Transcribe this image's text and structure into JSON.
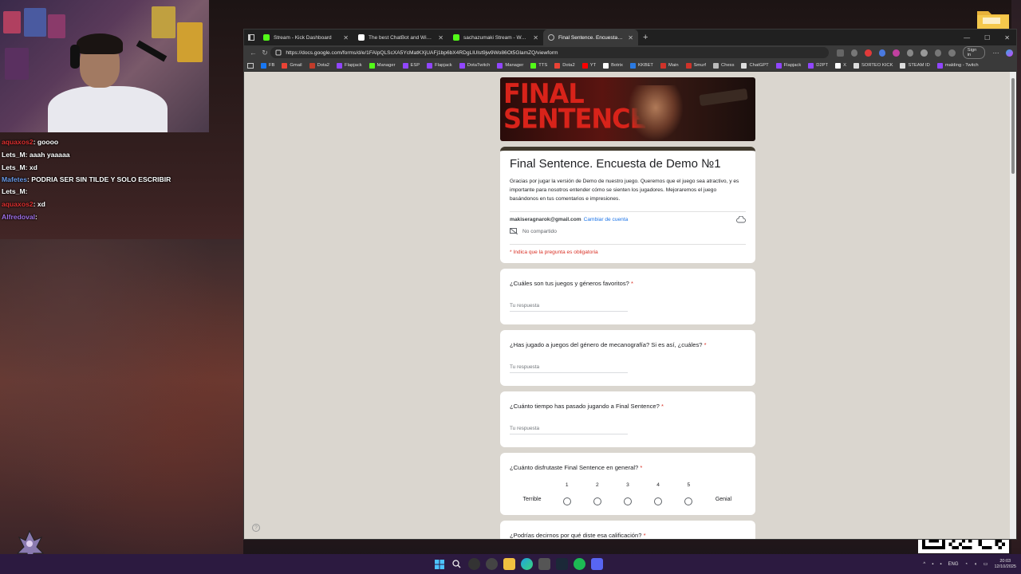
{
  "stream": {
    "chat": [
      {
        "user": "aquaxos2",
        "user_color": "#e03030",
        "text": ": goooo"
      },
      {
        "user": "Lets_M",
        "user_color": "#ffffff",
        "text": ": aaah yaaaaa"
      },
      {
        "user": "Lets_M",
        "user_color": "#ffffff",
        "text": ": xd"
      },
      {
        "user": "Mafetes",
        "user_color": "#6a9ae8",
        "text": ": PODRIA SER SIN TILDE Y SOLO ESCRIBIR"
      },
      {
        "user": "Lets_M",
        "user_color": "#ffffff",
        "text": ":"
      },
      {
        "user": "aquaxos2",
        "user_color": "#e03030",
        "text": ": xd"
      },
      {
        "user": "Alfredoval",
        "user_color": "#a070e8",
        "text": ":"
      }
    ]
  },
  "browser": {
    "tabs": [
      {
        "label": "Stream - Kick Dashboard",
        "icon": "kick-icon",
        "color": "#53fc18",
        "active": false
      },
      {
        "label": "The best ChatBot and Widgets for",
        "icon": "streamelements-icon",
        "color": "#ffffff",
        "active": false
      },
      {
        "label": "sachazumaki Stream - Watch Li...",
        "icon": "kick-icon",
        "color": "#53fc18",
        "active": false
      },
      {
        "label": "Final Sentence. Encuesta de Dem...",
        "icon": "globe-icon",
        "color": "#bbbbbb",
        "active": true
      }
    ],
    "url": "https://docs.google.com/forms/d/e/1FAIpQLScXA5YcMatKXjUAFj1bp6bX4RDgLlUlst9jw9Wo86Ot5GlamZQ/viewform",
    "signin_label": "Sign in",
    "bookmarks": [
      {
        "label": "FB",
        "color": "#1877f2"
      },
      {
        "label": "Gmail",
        "color": "#ea4335"
      },
      {
        "label": "Dota2",
        "color": "#c23c2a"
      },
      {
        "label": "Flapjack",
        "color": "#9146ff"
      },
      {
        "label": "Manager",
        "color": "#53fc18"
      },
      {
        "label": "ESP",
        "color": "#9146ff"
      },
      {
        "label": "Flapjack",
        "color": "#9146ff"
      },
      {
        "label": "DotaTwitch",
        "color": "#9146ff"
      },
      {
        "label": "Manager",
        "color": "#9146ff"
      },
      {
        "label": "TTS",
        "color": "#53fc18"
      },
      {
        "label": "Dota2",
        "color": "#ea4335"
      },
      {
        "label": "YT",
        "color": "#ff0000"
      },
      {
        "label": "Botrix",
        "color": "#ffffff"
      },
      {
        "label": "KKBET",
        "color": "#2a7ae2"
      },
      {
        "label": "Main",
        "color": "#d0332a"
      },
      {
        "label": "Smurf",
        "color": "#d0332a"
      },
      {
        "label": "Chess",
        "color": "#bbbbbb"
      },
      {
        "label": "ChatGPT",
        "color": "#dddddd"
      },
      {
        "label": "Flapjack",
        "color": "#9146ff"
      },
      {
        "label": "D2PT",
        "color": "#9146ff"
      },
      {
        "label": "X",
        "color": "#ffffff"
      },
      {
        "label": "SORTEO KICK",
        "color": "#dddddd"
      },
      {
        "label": "STEAM ID",
        "color": "#dddddd"
      },
      {
        "label": "malding - Twitch",
        "color": "#9146ff"
      }
    ]
  },
  "form": {
    "banner_title_line1": "FINAL",
    "banner_title_line2": "SENTENCE",
    "title": "Final Sentence. Encuesta de Demo №1",
    "description": "Gracias por jugar la versión de Demo de nuestro juego. Queremos que el juego sea atractivo, y es importante para nosotros entender cómo se sienten los jugadores. Mejoraremos el juego basándonos en tus comentarios e impresiones.",
    "account": "makiseragnarok@gmail.com",
    "switch_account": "Cambiar de cuenta",
    "not_shared": "No compartido",
    "required_note": "* Indica que la pregunta es obligatoria",
    "answer_placeholder": "Tu respuesta",
    "questions": [
      {
        "text": "¿Cuáles son tus juegos y géneros favoritos?",
        "required": "*"
      },
      {
        "text": "¿Has jugado a juegos del género de mecanografía? Si es así, ¿cuáles?",
        "required": "*"
      },
      {
        "text": "¿Cuánto tiempo has pasado jugando a Final Sentence?",
        "required": "*"
      },
      {
        "text": "¿Cuánto disfrutaste Final Sentence en general?",
        "required": "*"
      },
      {
        "text": "¿Podrías decirnos por qué diste esa calificación?",
        "required": "*"
      }
    ],
    "scale": {
      "low_label": "Terrible",
      "high_label": "Genial",
      "options": [
        "1",
        "2",
        "3",
        "4",
        "5"
      ]
    }
  },
  "taskbar": {
    "lang": "ENG",
    "time": "20:03",
    "date": "12/10/2025"
  }
}
